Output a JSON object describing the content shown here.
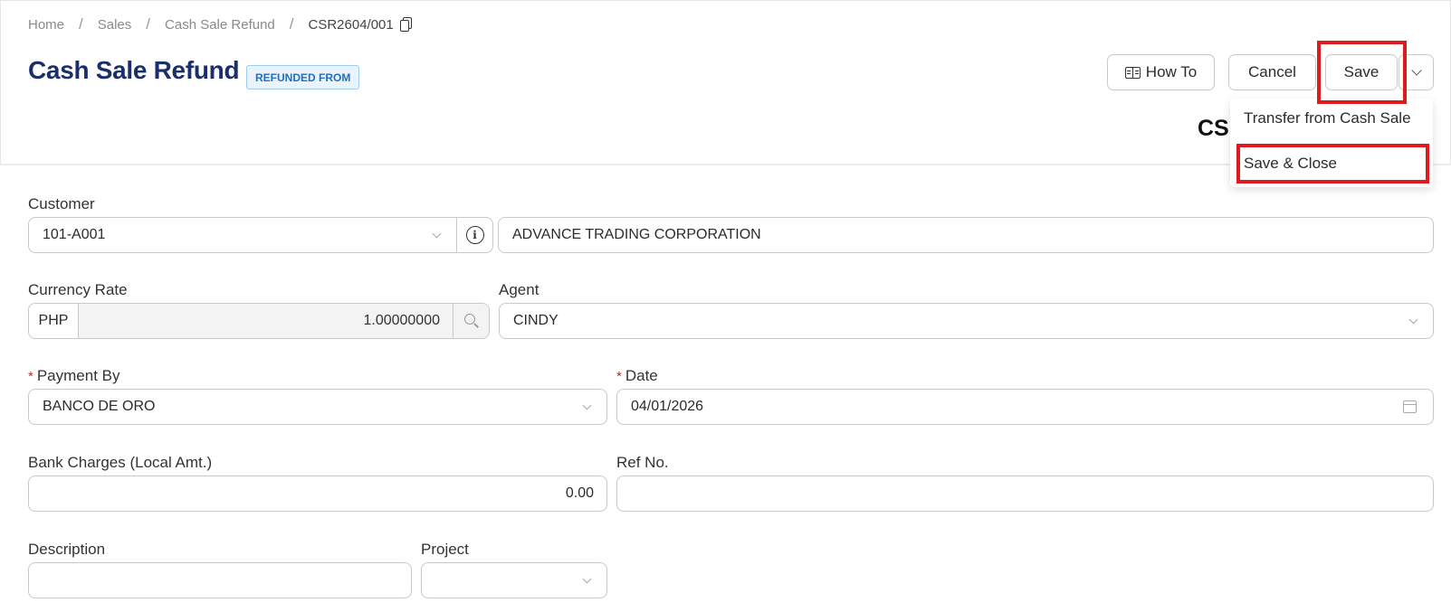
{
  "breadcrumb": {
    "items": [
      "Home",
      "Sales",
      "Cash Sale Refund"
    ],
    "current": "CSR2604/001"
  },
  "header": {
    "title": "Cash Sale Refund",
    "badge": "REFUNDED FROM",
    "doc_number_partial": "CSI"
  },
  "toolbar": {
    "howto_label": "How To",
    "cancel_label": "Cancel",
    "save_label": "Save"
  },
  "save_menu": {
    "items": [
      "Transfer from Cash Sale",
      "Save & Close"
    ]
  },
  "form": {
    "customer": {
      "label": "Customer",
      "code": "101-A001",
      "name": "ADVANCE TRADING CORPORATION"
    },
    "currency_rate": {
      "label": "Currency Rate",
      "currency": "PHP",
      "rate": "1.00000000"
    },
    "agent": {
      "label": "Agent",
      "value": "CINDY"
    },
    "payment_by": {
      "label": "Payment By",
      "value": "BANCO DE ORO",
      "required_mark": "*"
    },
    "date": {
      "label": "Date",
      "value": "04/01/2026",
      "required_mark": "*"
    },
    "bank_charges": {
      "label": "Bank Charges (Local Amt.)",
      "value": "0.00"
    },
    "ref_no": {
      "label": "Ref No.",
      "value": ""
    },
    "description": {
      "label": "Description",
      "value": ""
    },
    "project": {
      "label": "Project",
      "value": ""
    }
  },
  "colors": {
    "title": "#1a2f6b",
    "badge_text": "#1f6fc4",
    "badge_bg": "#e9f4ff",
    "highlight": "#e0191f",
    "required": "#e0191f"
  }
}
